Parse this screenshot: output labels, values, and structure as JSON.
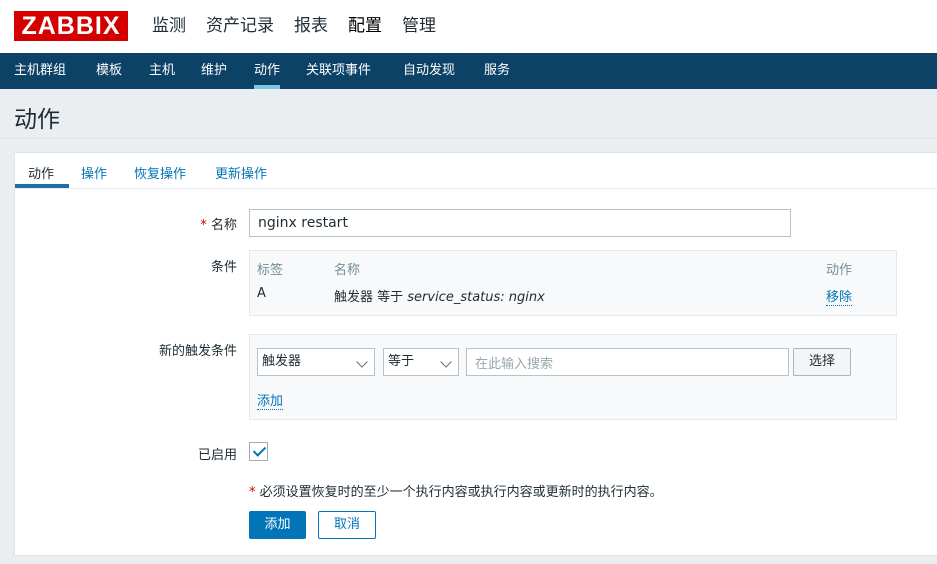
{
  "logo": "ZABBIX",
  "top_menu": [
    "监测",
    "资产记录",
    "报表",
    "配置",
    "管理"
  ],
  "sub_menu": [
    "主机群组",
    "模板",
    "主机",
    "维护",
    "动作",
    "关联项事件",
    "自动发现",
    "服务"
  ],
  "page_title": "动作",
  "tabs": [
    "动作",
    "操作",
    "恢复操作",
    "更新操作"
  ],
  "form": {
    "name_label": "名称",
    "required_mark": "*",
    "name_value": "nginx restart",
    "conditions_label": "条件",
    "conditions_table": {
      "headers": [
        "标签",
        "名称",
        "动作"
      ],
      "rows": [
        {
          "tag": "A",
          "name_prefix": "触发器 等于 ",
          "name_value": "service_status: nginx",
          "action": "移除"
        }
      ]
    },
    "new_condition_label": "新的触发条件",
    "condition_type_selected": "触发器",
    "operator_selected": "等于",
    "search_placeholder": "在此输入搜索",
    "select_button": "选择",
    "add_link": "添加",
    "enabled_label": "已启用",
    "enabled": true,
    "note": "必须设置恢复时的至少一个执行内容或执行内容或更新时的执行内容。",
    "submit_button": "添加",
    "cancel_button": "取消"
  },
  "colors": {
    "logo_red": "#d40000",
    "nav_blue": "#0b4266",
    "accent": "#0275b8"
  }
}
